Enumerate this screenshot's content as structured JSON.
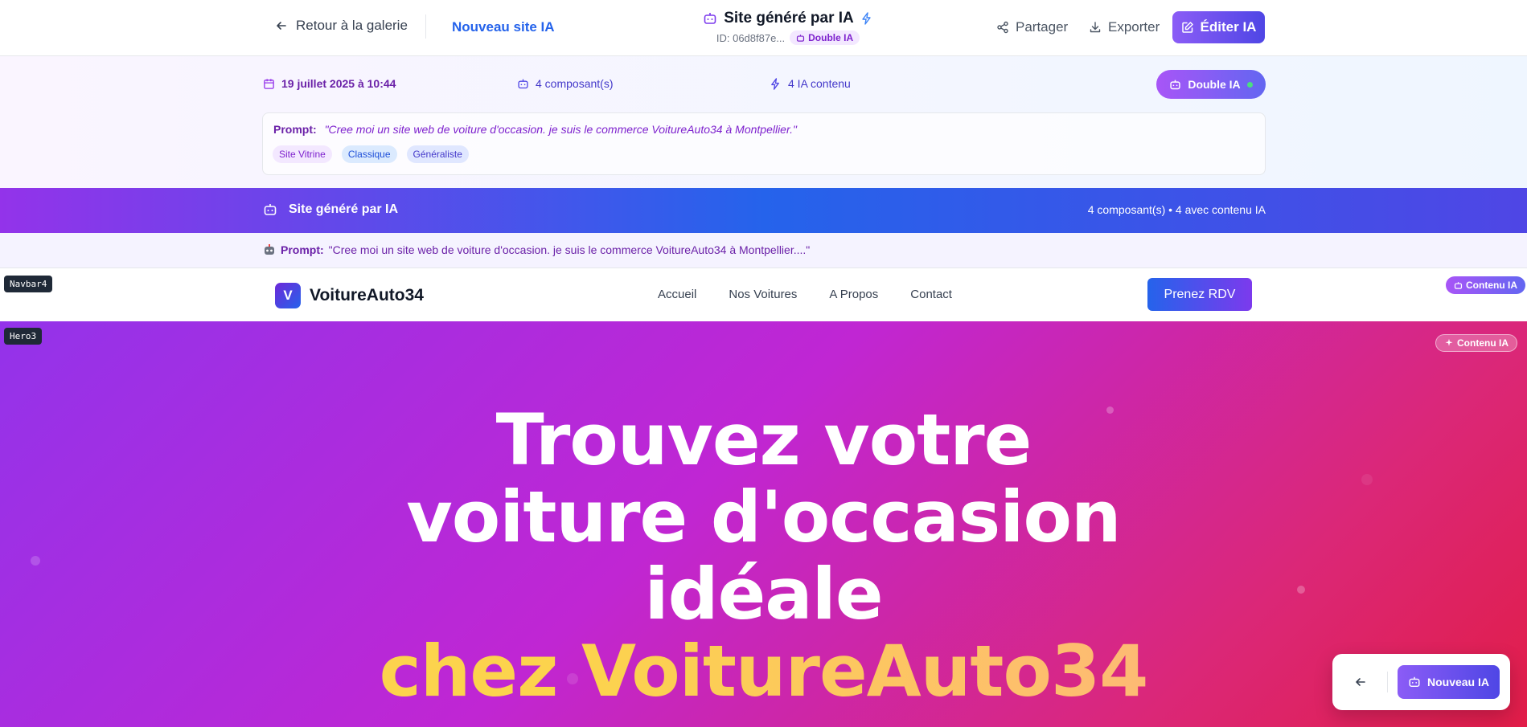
{
  "topbar": {
    "back_label": "Retour à la galerie",
    "new_site_label": "Nouveau site IA",
    "title": "Site généré par IA",
    "id_label": "ID: 06d8f87e...",
    "dual_badge": "Double IA",
    "share_label": "Partager",
    "export_label": "Exporter",
    "edit_label": "Éditer IA"
  },
  "info": {
    "date": "19 juillet 2025 à 10:44",
    "components": "4 composant(s)",
    "ia_content": "4 IA contenu",
    "dual_pill": "Double IA",
    "prompt_label": "Prompt:",
    "prompt_text": "\"Cree moi un site web de voiture d'occasion. je suis le commerce VoitureAuto34 à Montpellier.\"",
    "tags": [
      "Site Vitrine",
      "Classique",
      "Généraliste"
    ]
  },
  "banner": {
    "title": "Site généré par IA",
    "stats": "4 composant(s) • 4 avec contenu IA"
  },
  "prompt_strip": {
    "label": "Prompt:",
    "text": "\"Cree moi un site web de voiture d'occasion. je suis le commerce VoitureAuto34 à Montpellier....\""
  },
  "site_nav": {
    "component_tag": "Navbar4",
    "logo_letter": "V",
    "brand": "VoitureAuto34",
    "links": [
      "Accueil",
      "Nos Voitures",
      "A Propos",
      "Contact"
    ],
    "cta": "Prenez RDV",
    "ia_chip": "Contenu IA"
  },
  "hero": {
    "component_tag": "Hero3",
    "ia_chip": "Contenu IA",
    "line1": "Trouvez votre",
    "line2": "voiture d'occasion",
    "line3": "idéale",
    "line4_a": "chez",
    "line4_b": "VoitureAuto34"
  },
  "float_card": {
    "button_label": "Nouveau IA"
  },
  "colors": {
    "accent_purple": "#8b5cf6",
    "accent_blue": "#2563eb",
    "hero_start": "#9333ea",
    "hero_end": "#e11d48",
    "highlight": "#fcd34d"
  }
}
